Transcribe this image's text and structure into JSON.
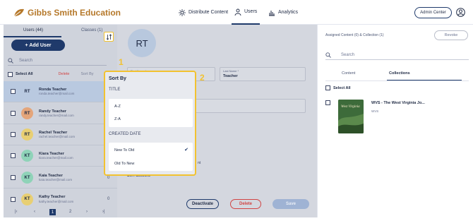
{
  "brand": {
    "name": "Gibbs Smith Education",
    "color": "#b5782a"
  },
  "nav": {
    "distribute": "Distribute Content",
    "users": "Users",
    "analytics": "Analytics",
    "admin_center": "Admin Center"
  },
  "left": {
    "tab_users": "Users (44)",
    "tab_classes": "Classes (1)",
    "add_user": "+ Add User",
    "search_placeholder": "Search",
    "select_all": "Select All",
    "delete": "Delete",
    "sort_by_short": "Sort By",
    "users": [
      {
        "initials": "RT",
        "name": "Ronda Teacher",
        "email": "ronda.teacher@mail.com",
        "count": "",
        "avatar_color": "#b9c9e0"
      },
      {
        "initials": "RT",
        "name": "Randy Teacher",
        "email": "randy.teacher@mail.com",
        "count": "",
        "avatar_color": "#e4a57a"
      },
      {
        "initials": "RT",
        "name": "Rachel Teacher",
        "email": "rachel.teacher@mail.com",
        "count": "",
        "avatar_color": "#e8cf73"
      },
      {
        "initials": "KT",
        "name": "Kiara Teacher",
        "email": "kiara.teacher@mail.com",
        "count": "",
        "avatar_color": "#8fd3b8"
      },
      {
        "initials": "KT",
        "name": "Kaia Teacher",
        "email": "kaia.teacher@mail.com",
        "count": "0",
        "avatar_color": "#8fd3b8"
      },
      {
        "initials": "KT",
        "name": "Kathy Teacher",
        "email": "kathy.teacher@mail.com",
        "count": "0",
        "avatar_color": "#e8cf73"
      }
    ],
    "pager": {
      "prev_first": "|‹",
      "prev": "‹",
      "page1": "1",
      "page2": "2",
      "next": "›",
      "last": "›|"
    }
  },
  "middle": {
    "avatar_initials": "RT",
    "first_name_label": "First Name *",
    "last_name_label": "Last Name *",
    "last_name_value": "Teacher",
    "partial_text": "nt",
    "set_password": "Set Password",
    "deactivate": "Deactivate",
    "delete": "Delete",
    "save": "Save"
  },
  "sort_menu": {
    "title": "Sort By",
    "title_section": "TITLE",
    "a_z": "A-Z",
    "z_a": "Z-A",
    "created_section": "CREATED DATE",
    "new_to_old": "New To Old",
    "old_to_new": "Old To New",
    "selected": "new_to_old",
    "check": "✔"
  },
  "steps": {
    "one": "1",
    "two": "2"
  },
  "right": {
    "title": "Assigned Content (0) & Collection (1)",
    "revoke": "Revoke",
    "search_placeholder": "Search",
    "tab_content": "Content",
    "tab_collections": "Collections",
    "select_all": "Select All",
    "cover_text": "West Virginia",
    "book_title": "WVS - The West Virginia Jo...",
    "book_code": "WVS"
  },
  "colors": {
    "primary": "#1f3a6b",
    "highlight": "#f2c230",
    "danger": "#d14444"
  }
}
